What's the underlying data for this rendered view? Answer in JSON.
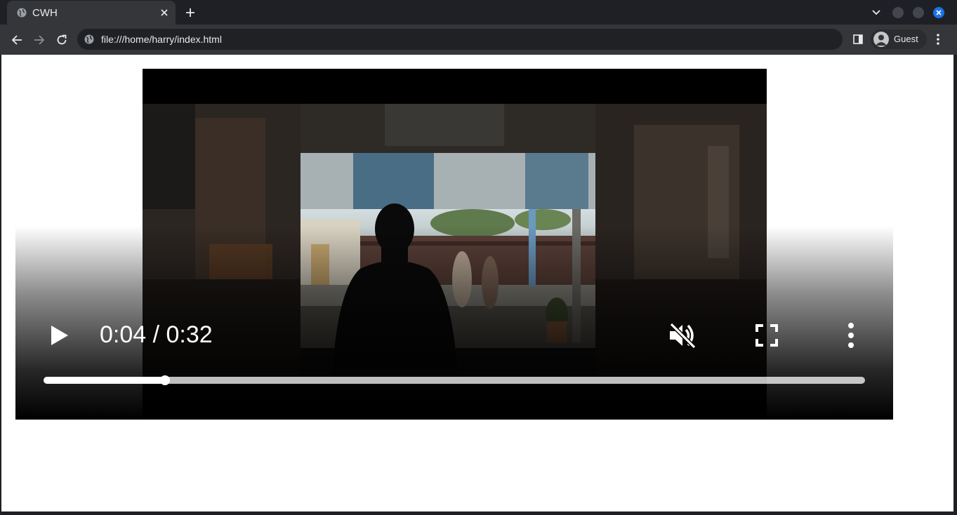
{
  "browser": {
    "tab": {
      "title": "CWH",
      "favicon": "globe-icon"
    },
    "address_bar": {
      "url": "file:///home/harry/index.html",
      "icon": "globe-icon"
    },
    "profile": {
      "label": "Guest"
    },
    "accent_color": "#1a73e8"
  },
  "video_player": {
    "state": "paused",
    "muted": true,
    "time_display": "0:04 / 0:32",
    "progress_fraction": 0.148,
    "icons": {
      "play": "play-icon",
      "mute": "volume-muted-icon",
      "fullscreen": "fullscreen-icon",
      "more": "more-vert-icon"
    }
  }
}
